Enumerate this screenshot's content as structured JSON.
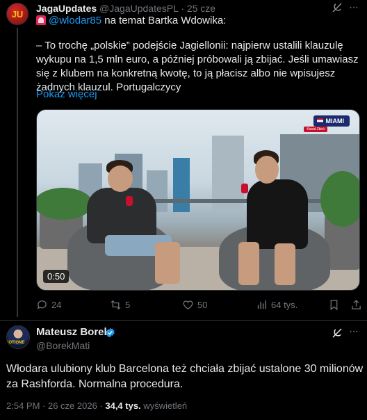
{
  "quoted": {
    "author_name": "JagaUpdates",
    "author_handle": "@JagaUpdatesPL",
    "date": "· 25 cze",
    "avatar_text": "JU",
    "mention": "@wlodar85",
    "intro": " na temat Bartka Wdowika:",
    "body": "– To trochę „polskie” podejście Jagiellonii: najpierw ustalili klauzulę wykupu na 1,5 mln euro, a później próbowali ją zbijać. Jeśli umawiasz się z klubem na konkretną kwotę, to ją płacisz albo nie wpisujesz żadnych klauzul. Portugalczycy",
    "show_more": "Pokaż więcej",
    "video": {
      "duration": "0:50",
      "badge": "MIAMI",
      "badge_sub": "Kanał Zbiró"
    },
    "stats": {
      "replies": "24",
      "reposts": "5",
      "likes": "50",
      "views": "64 tys."
    }
  },
  "main": {
    "author_name": "Mateusz Borek",
    "author_handle": "@BorekMati",
    "body": "Włodara ulubiony klub Barcelona też chciała zbijać ustalone 30 milionów za Rashforda. Normalna procedura.",
    "time": "2:54 PM · 26 cze 2026 · ",
    "views_count": "34,4 tys.",
    "views_label": " wyświetleń"
  },
  "icons": {
    "grok": "grok-icon",
    "more": "more-icon",
    "reply": "reply-icon",
    "repost": "repost-icon",
    "like": "heart-icon",
    "views": "views-icon",
    "bookmark": "bookmark-icon",
    "share": "share-icon",
    "verified": "verified-badge-icon"
  },
  "colors": {
    "accent": "#1d9bf0",
    "muted": "#71767b",
    "text": "#e7e9ea",
    "background": "#000000"
  }
}
